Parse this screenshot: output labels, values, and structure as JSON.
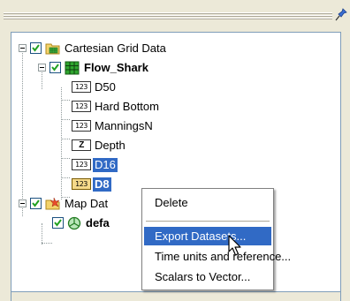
{
  "tree": {
    "items": [
      {
        "label": "Cartesian Grid Data"
      },
      {
        "label": "Flow_Shark"
      },
      {
        "label": "D50",
        "badge": "123"
      },
      {
        "label": "Hard Bottom",
        "badge": "123"
      },
      {
        "label": "ManningsN",
        "badge": "123"
      },
      {
        "label": "Depth",
        "badge": "Z"
      },
      {
        "label": "D16",
        "badge": "123"
      },
      {
        "label": "D8",
        "badge": "123"
      },
      {
        "label": "Map Dat"
      },
      {
        "label": "defa"
      }
    ]
  },
  "context_menu": {
    "items": [
      {
        "label": "Delete"
      },
      {
        "label": "Export Datasets..."
      },
      {
        "label": "Time units and reference..."
      },
      {
        "label": "Scalars to Vector..."
      }
    ]
  },
  "colors": {
    "selection": "#316ac5",
    "panel_border": "#7f9db9",
    "background": "#ece9d8"
  },
  "icons": [
    "folder-grid-icon",
    "grid-icon",
    "dataset-icon",
    "elevation-icon",
    "map-icon",
    "coverage-icon",
    "pin-icon"
  ]
}
